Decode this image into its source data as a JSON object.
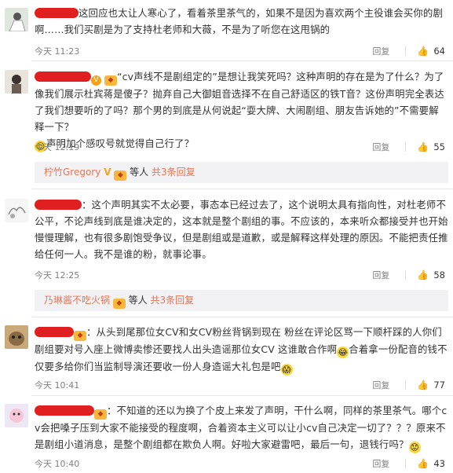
{
  "comments": [
    {
      "text": "这回应也太让人寒心了，看着茶里茶气的，如果不是因为喜欢两个主役谁会买你的剧啊……我们买剧是为了支持杜老师和大薇，不是为了听您在这甩锅的",
      "time": "今天 11:23",
      "reply_label": "回复",
      "likes": "64"
    },
    {
      "text_part1": "“cv声线不是剧组定的”是想让我笑死吗？这种声明的存在是为了什么？为了像我们展示杜宾蒋是傻子？抛弃自己大御姐音选择不在自己舒适区的铁T音？这份声明完全表达了我们想要听的了吗？那个男的到底是从何说起“耍大牌、大闹剧组、朋友告诉她的”不需要解释一下？",
      "text_part2": "声明加个感叹号就觉得自己行了？",
      "time": "今天 12:19",
      "reply_label": "回复",
      "likes": "55"
    },
    {
      "text": "：这个声明其实不太必要，事态本已经过去了，这个说明太具有指向性，对杜老师不公平，不论声线到底是谁决定的，这本就是整个剧组的事。不应该的，本来听众都接受并也开始慢慢理解，也有很多剧饱受争议，但是剧组或是道歉，或是解释这样处理的原因。不能把责任推给任何一人。我不是谁的粉，就事论事。",
      "time": "今天 12:25",
      "reply_label": "回复",
      "likes": "58"
    },
    {
      "text_part1": "：从头到尾那位女CV和女CV粉丝背锅到现在 粉丝在评论区骂一下顺杆踩的人你们剧组要对号入座上微博卖惨还要找人出头造谣那位女CV 这谁敢合作啊",
      "text_part2": "合着拿一份配音的钱不仅要多给你们当监制导演还要收一份人身造谣大礼包是吧",
      "time": "今天 10:41",
      "reply_label": "回复",
      "likes": "77"
    },
    {
      "text": "：不知道的还以为换了个皮上来发了声明，干什么啊，同样的茶里茶气。哪个cv会把嗓子压到大家不能接受的程度啊，合着资本主义可以让小cv自己决定一切了？？？原来不是剧组小道消息，是整个剧组都在欺负人啊。好啦大家避雷吧，最后一句，退钱行吗？",
      "time": "今天 10:40",
      "reply_label": "回复",
      "likes": "43"
    }
  ],
  "sub_replies": [
    {
      "name": "柠竹Gregory",
      "verified": "V",
      "middle": "等人",
      "more": "共3条回复"
    },
    {
      "name": "乃琳酱不吃火锅",
      "middle": "等人",
      "more": "共3条回复"
    }
  ]
}
